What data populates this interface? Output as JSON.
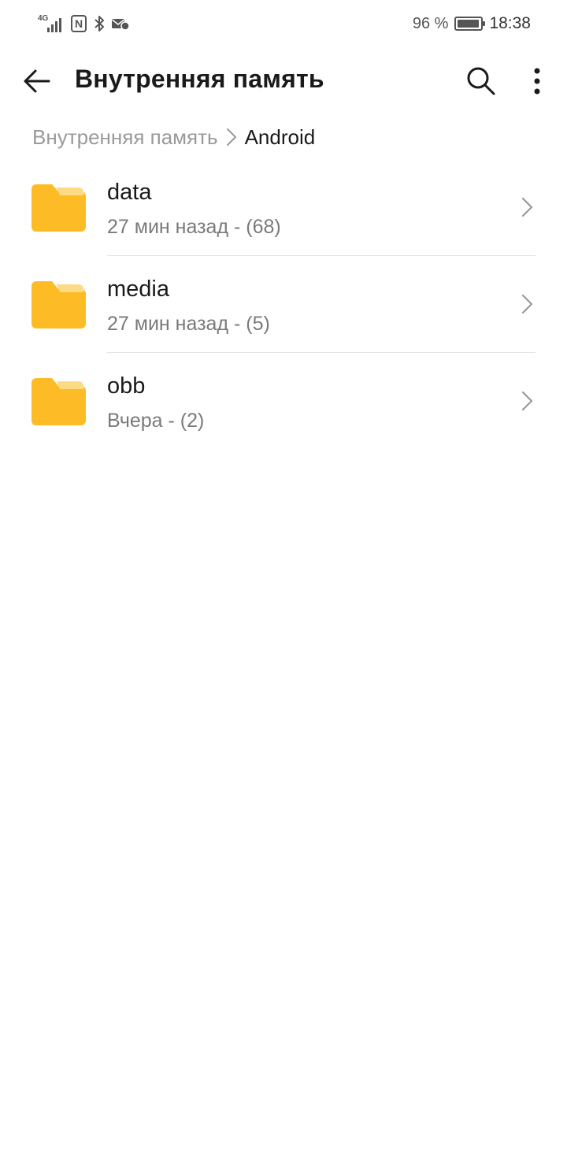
{
  "status_bar": {
    "network_type": "4G",
    "nfc_label": "N",
    "bluetooth_icon": "bluetooth-icon",
    "message_icon": "message-icon",
    "battery_percent": "96 %",
    "battery_level": 0.96,
    "time": "18:38"
  },
  "app_bar": {
    "title": "Внутренняя память",
    "back_icon": "arrow-left-icon",
    "search_icon": "search-icon",
    "more_icon": "more-vertical-icon"
  },
  "breadcrumb": {
    "root": "Внутренняя память",
    "current": "Android"
  },
  "files": [
    {
      "name": "data",
      "meta": "27 мин назад - (68)",
      "icon": "folder-icon"
    },
    {
      "name": "media",
      "meta": "27 мин назад - (5)",
      "icon": "folder-icon"
    },
    {
      "name": "obb",
      "meta": "Вчера - (2)",
      "icon": "folder-icon"
    }
  ],
  "colors": {
    "folder": "#FDBB26",
    "folder_tab": "#FDDB85",
    "text_primary": "#1a1a1a",
    "text_secondary": "#7a7a7a"
  }
}
